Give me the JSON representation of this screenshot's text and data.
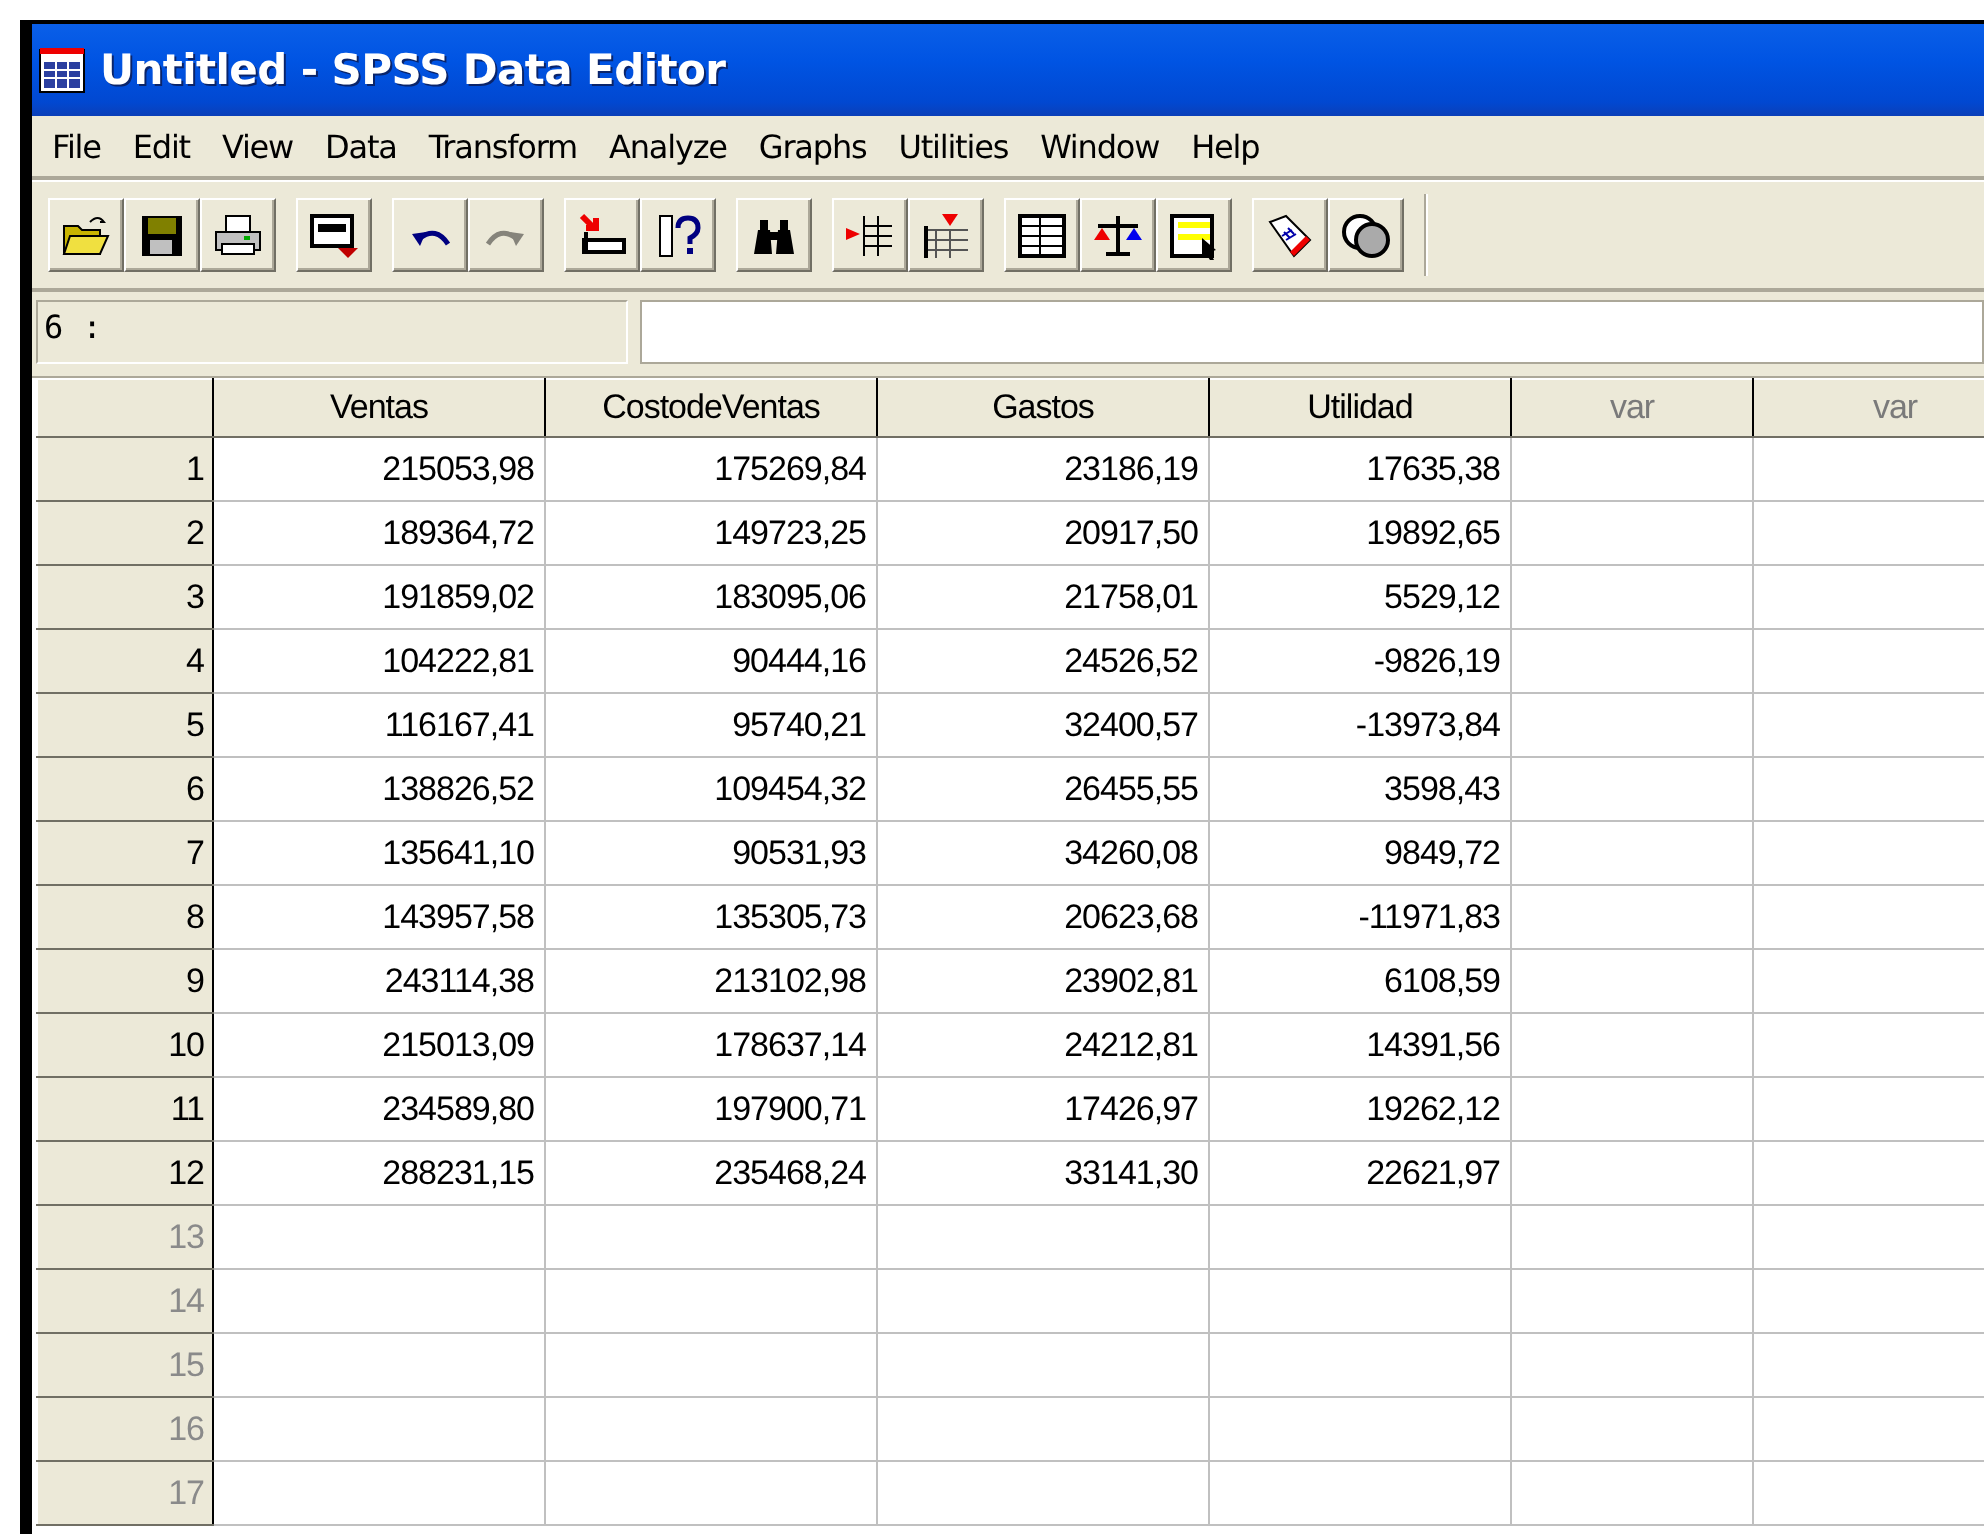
{
  "window": {
    "title": "Untitled - SPSS Data Editor"
  },
  "menu": [
    "File",
    "Edit",
    "View",
    "Data",
    "Transform",
    "Analyze",
    "Graphs",
    "Utilities",
    "Window",
    "Help"
  ],
  "toolbar": [
    [
      {
        "kind": "open",
        "disabled": false
      },
      {
        "kind": "save",
        "disabled": false
      },
      {
        "kind": "print",
        "disabled": false
      }
    ],
    [
      {
        "kind": "recall",
        "disabled": false
      }
    ],
    [
      {
        "kind": "undo",
        "disabled": false
      },
      {
        "kind": "redo",
        "disabled": true
      }
    ],
    [
      {
        "kind": "goto",
        "disabled": false
      },
      {
        "kind": "variables",
        "disabled": false
      }
    ],
    [
      {
        "kind": "find",
        "disabled": false
      }
    ],
    [
      {
        "kind": "insert_case",
        "disabled": false
      },
      {
        "kind": "insert_var",
        "disabled": false
      }
    ],
    [
      {
        "kind": "split",
        "disabled": false
      },
      {
        "kind": "weight",
        "disabled": false
      },
      {
        "kind": "select",
        "disabled": false
      }
    ],
    [
      {
        "kind": "labels",
        "disabled": false
      },
      {
        "kind": "sets",
        "disabled": false
      }
    ]
  ],
  "cell_editor": {
    "reference": "6 :"
  },
  "grid": {
    "columns": [
      {
        "name": "Ventas",
        "defined": true
      },
      {
        "name": "CostodeVentas",
        "defined": true
      },
      {
        "name": "Gastos",
        "defined": true
      },
      {
        "name": "Utilidad",
        "defined": true
      },
      {
        "name": "var",
        "defined": false
      },
      {
        "name": "var",
        "defined": false
      }
    ],
    "rows": [
      {
        "number": "1",
        "has_data": true,
        "cells": [
          "215053,98",
          "175269,84",
          "23186,19",
          "17635,38"
        ]
      },
      {
        "number": "2",
        "has_data": true,
        "cells": [
          "189364,72",
          "149723,25",
          "20917,50",
          "19892,65"
        ]
      },
      {
        "number": "3",
        "has_data": true,
        "cells": [
          "191859,02",
          "183095,06",
          "21758,01",
          "5529,12"
        ]
      },
      {
        "number": "4",
        "has_data": true,
        "cells": [
          "104222,81",
          "90444,16",
          "24526,52",
          "-9826,19"
        ]
      },
      {
        "number": "5",
        "has_data": true,
        "cells": [
          "116167,41",
          "95740,21",
          "32400,57",
          "-13973,84"
        ]
      },
      {
        "number": "6",
        "has_data": true,
        "cells": [
          "138826,52",
          "109454,32",
          "26455,55",
          "3598,43"
        ]
      },
      {
        "number": "7",
        "has_data": true,
        "cells": [
          "135641,10",
          "90531,93",
          "34260,08",
          "9849,72"
        ]
      },
      {
        "number": "8",
        "has_data": true,
        "cells": [
          "143957,58",
          "135305,73",
          "20623,68",
          "-11971,83"
        ]
      },
      {
        "number": "9",
        "has_data": true,
        "cells": [
          "243114,38",
          "213102,98",
          "23902,81",
          "6108,59"
        ]
      },
      {
        "number": "10",
        "has_data": true,
        "cells": [
          "215013,09",
          "178637,14",
          "24212,81",
          "14391,56"
        ]
      },
      {
        "number": "11",
        "has_data": true,
        "cells": [
          "234589,80",
          "197900,71",
          "17426,97",
          "19262,12"
        ]
      },
      {
        "number": "12",
        "has_data": true,
        "cells": [
          "288231,15",
          "235468,24",
          "33141,30",
          "22621,97"
        ]
      },
      {
        "number": "13",
        "has_data": false,
        "cells": []
      },
      {
        "number": "14",
        "has_data": false,
        "cells": []
      },
      {
        "number": "15",
        "has_data": false,
        "cells": []
      },
      {
        "number": "16",
        "has_data": false,
        "cells": []
      },
      {
        "number": "17",
        "has_data": false,
        "cells": []
      }
    ]
  }
}
